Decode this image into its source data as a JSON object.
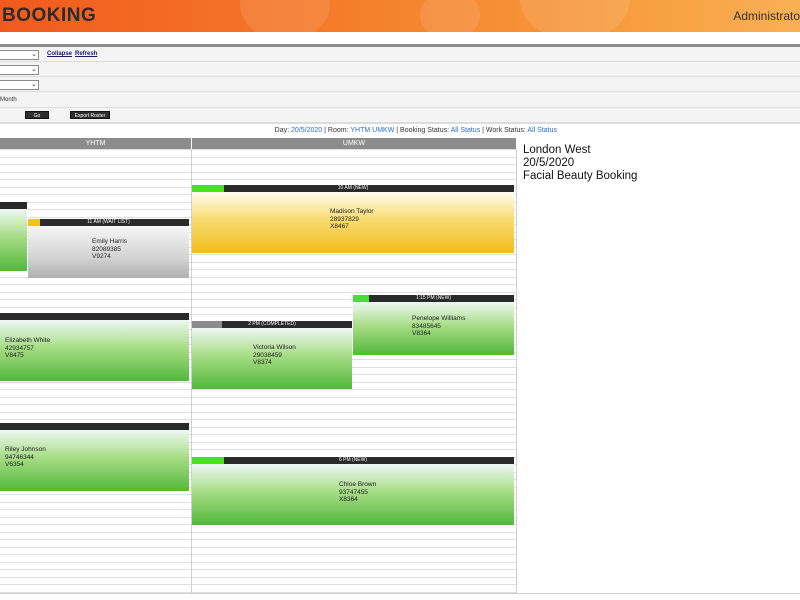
{
  "header": {
    "title": "BOOKING",
    "user": "Administrator"
  },
  "controls": {
    "collapse": "Collapse",
    "refresh": "Refresh",
    "month_label": "Month",
    "go": "Go",
    "export": "Export Roster"
  },
  "filter": {
    "day_label": "Day:",
    "day": "20/5/2020",
    "room_label": "| Room:",
    "room": "YHTM UMKW",
    "booking_label": "| Booking Status:",
    "booking": "All Status",
    "work_label": "| Work Status:",
    "work": "All Status"
  },
  "columns": [
    "YHTM",
    "UMKW"
  ],
  "info": {
    "location": "London West",
    "date": "20/5/2020",
    "service": "Facial Beauty Booking"
  },
  "bookings": [
    {
      "header": "",
      "name": "",
      "phone": "",
      "ref": "",
      "status_color": "#2a2a2a",
      "style": "green"
    },
    {
      "header": "11 AM (WAIT LIST)",
      "name": "Emily Harris",
      "phone": "82089385",
      "ref": "V9274",
      "status_color": "#f2c40f",
      "style": "grey"
    },
    {
      "header": "10 AM (NEW)",
      "name": "Madison Taylor",
      "phone": "28937829",
      "ref": "X8467",
      "status_color": "#3ee62a",
      "style": "yellow"
    },
    {
      "header": "",
      "name": "Elizabeth White",
      "phone": "42934757",
      "ref": "V8475",
      "status_color": "#2a2a2a",
      "style": "green"
    },
    {
      "header": "2 PM (COMPLETED)",
      "name": "Victoria Wilson",
      "phone": "29038459",
      "ref": "V8374",
      "status_color": "#8c8c8c",
      "style": "green"
    },
    {
      "header": "1:15 PM (NEW)",
      "name": "Penelope Williams",
      "phone": "83485645",
      "ref": "V8364",
      "status_color": "#3ee62a",
      "style": "green"
    },
    {
      "header": "",
      "name": "Riley Johnson",
      "phone": "94746344",
      "ref": "V6354",
      "status_color": "#2a2a2a",
      "style": "green"
    },
    {
      "header": "6 PM (NEW)",
      "name": "Chloe Brown",
      "phone": "93747455",
      "ref": "X8364",
      "status_color": "#3ee62a",
      "style": "green"
    }
  ]
}
